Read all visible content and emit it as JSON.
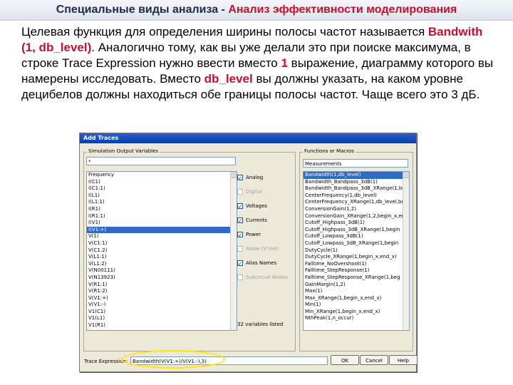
{
  "header": {
    "title_main": "Специальные виды анализа",
    "title_sep": " - ",
    "title_sub": "Анализ эффективности моделирования"
  },
  "paragraph": {
    "p1": "Целевая функция для определения ширины полосы частот называется ",
    "p2": "Bandwith (1, db_level)",
    "p3": ". Аналогично тому, как вы уже делали это при поиске максимума, в строке Trace Expression нужно ввести вместо ",
    "p4": "1",
    "p5": " выражение, диаграмму которого вы намерены исследовать. Вместо ",
    "p6": "db_level",
    "p7": " вы должны указать, на каком уровне децибелов должны находиться обе границы полосы частот. Чаще всего это 3 дБ."
  },
  "dialog": {
    "title": "Add Traces",
    "left_group_label": "Simulation Output Variables",
    "filter_value": "*",
    "variables": [
      "Frequency",
      "I(C1)",
      "I(C1:1)",
      "I(L1)",
      "I(L1:1)",
      "I(R1)",
      "I(R1:1)",
      "I(V1)",
      "I(V1:+)",
      "V(1)",
      "V(C1:1)",
      "V(C1:2)",
      "V(L1:1)",
      "V(L1:2)",
      "V(N00111)",
      "V(N13923)",
      "V(R1:1)",
      "V(R1:2)",
      "V(V1:+)",
      "V(V1:-)",
      "V1(C1)",
      "V1(L1)",
      "V1(R1)"
    ],
    "selected_variable": 8,
    "checkboxes": [
      {
        "label": "Analog",
        "checked": true,
        "enabled": true
      },
      {
        "label": "Digital",
        "checked": false,
        "enabled": false
      },
      {
        "label": "Voltages",
        "checked": true,
        "enabled": true
      },
      {
        "label": "Currents",
        "checked": true,
        "enabled": true
      },
      {
        "label": "Power",
        "checked": true,
        "enabled": true
      },
      {
        "label": "Noise (V²/Hz)",
        "checked": false,
        "enabled": false
      },
      {
        "label": "Alias Names",
        "checked": true,
        "enabled": true
      },
      {
        "label": "Subcircuit Nodes",
        "checked": false,
        "enabled": false
      }
    ],
    "count_text": "32 variables listed",
    "right_group_label": "Functions or Macros",
    "function_select": "Measurements",
    "functions": [
      "Bandwidth(1,db_level)",
      "Bandwidth_Bandpass_3dB(1)",
      "Bandwidth_Bandpass_3dB_XRange(1,beg",
      "CenterFrequency(1,db_level)",
      "CenterFrequency_XRange(1,db_level,beg",
      "ConversionGain(1,2)",
      "ConversionGain_XRange(1,2,begin_x,end",
      "Cutoff_Highpass_3dB(1)",
      "Cutoff_Highpass_3dB_XRange(1,begin",
      "Cutoff_Lowpass_3dB(1)",
      "Cutoff_Lowpass_3dB_XRange(1,begin",
      "DutyCycle(1)",
      "DutyCycle_XRange(1,begin_x,end_x)",
      "Falltime_NoOvershoot(1)",
      "Falltime_StepResponse(1)",
      "Falltime_StepResponse_XRange(1,beg",
      "GainMargin(1,2)",
      "Max(1)",
      "Max_XRange(1,begin_x,end_x)",
      "Min(1)",
      "Min_XRange(1,begin_x,end_x)",
      "NthPeak(1,n_occur)"
    ],
    "selected_function": 0,
    "trace_label": "Trace Expression:",
    "trace_value": "Bandwidth(V(V1:+)/V(V1:-),3)",
    "ok_label": "OK",
    "cancel_label": "Cancel",
    "help_label": "Help"
  }
}
